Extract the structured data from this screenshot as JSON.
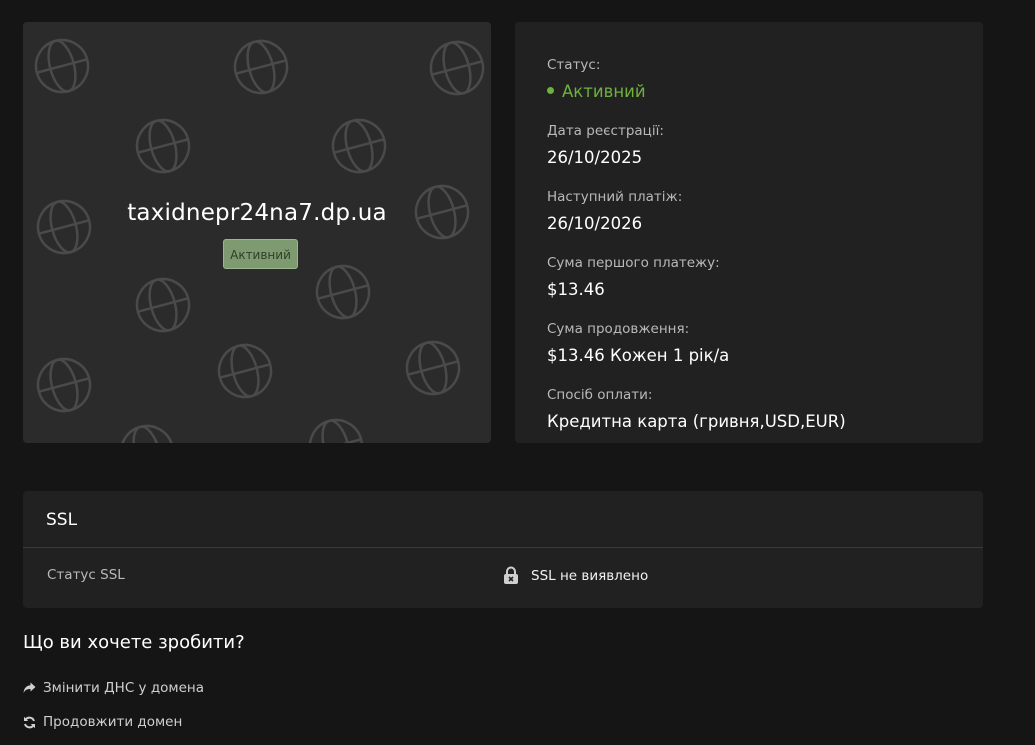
{
  "domain_card": {
    "domain": "taxidnepr24na7.dp.ua",
    "badge": "Активний"
  },
  "details": {
    "status_label": "Статус:",
    "status_value": "Активний",
    "reg_date_label": "Дата реєстрації:",
    "reg_date_value": "26/10/2025",
    "next_payment_label": "Наступний платіж:",
    "next_payment_value": "26/10/2026",
    "first_payment_label": "Сума першого платежу:",
    "first_payment_value": "$13.46",
    "renewal_label": "Сума продовження:",
    "renewal_value": "$13.46 Кожен 1 рік/а",
    "payment_method_label": "Спосіб оплати:",
    "payment_method_value": "Кредитна карта (гривня,USD,EUR)"
  },
  "ssl": {
    "title": "SSL",
    "status_label": "Статус SSL",
    "status_value": "SSL не виявлено"
  },
  "actions": {
    "title": "Що ви хочете зробити?",
    "items": [
      {
        "label": "Змінити ДНС у домена",
        "icon": "share-arrow-icon"
      },
      {
        "label": "Продовжити домен",
        "icon": "refresh-icon"
      }
    ]
  },
  "colors": {
    "background": "#151515",
    "card": "#212121",
    "domain_card": "#2b2b2b",
    "accent_green": "#6eb13d",
    "badge_green": "#7e9a70"
  }
}
